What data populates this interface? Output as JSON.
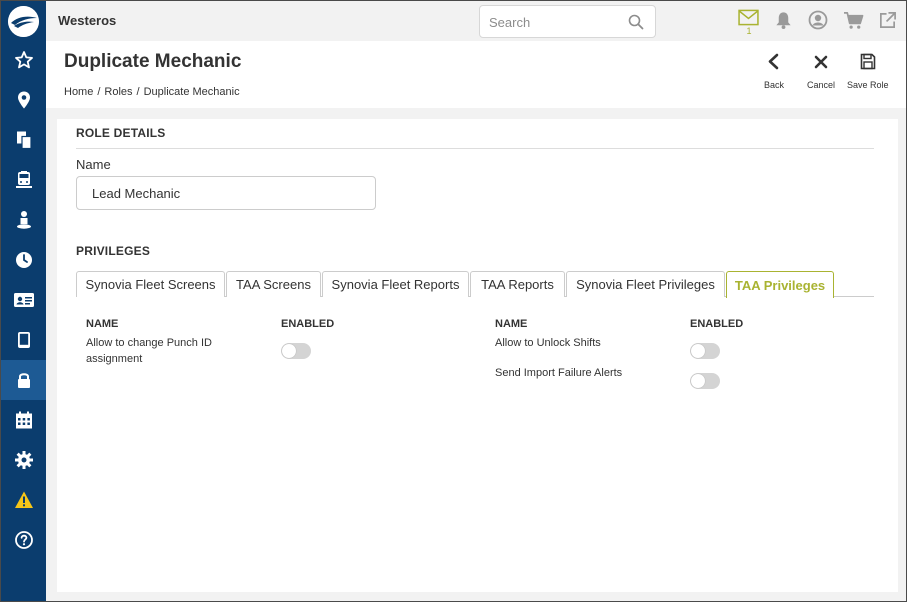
{
  "topbar": {
    "org_name": "Westeros",
    "search_placeholder": "Search",
    "mail_count": "1"
  },
  "header": {
    "title": "Duplicate Mechanic",
    "breadcrumb": [
      "Home",
      "Roles",
      "Duplicate Mechanic"
    ],
    "actions": {
      "back": "Back",
      "cancel": "Cancel",
      "save": "Save Role"
    }
  },
  "role_details": {
    "heading": "ROLE DETAILS",
    "name_label": "Name",
    "name_value": "Lead Mechanic"
  },
  "privileges": {
    "heading": "PRIVILEGES",
    "tabs": [
      "Synovia Fleet Screens",
      "TAA Screens",
      "Synovia Fleet Reports",
      "TAA Reports",
      "Synovia Fleet Privileges",
      "TAA Privileges"
    ],
    "active_tab": "TAA Privileges",
    "columns": {
      "name": "NAME",
      "enabled": "ENABLED"
    },
    "left_items": [
      {
        "label": "Allow to change Punch ID assignment",
        "enabled": false
      }
    ],
    "right_items": [
      {
        "label": "Allow to Unlock Shifts",
        "enabled": false
      },
      {
        "label": "Send Import Failure Alerts",
        "enabled": false
      }
    ]
  },
  "sidebar": {
    "items": [
      {
        "icon": "star-icon"
      },
      {
        "icon": "map-pin-icon"
      },
      {
        "icon": "documents-icon"
      },
      {
        "icon": "bus-icon"
      },
      {
        "icon": "person-icon"
      },
      {
        "icon": "clock-icon"
      },
      {
        "icon": "id-card-icon"
      },
      {
        "icon": "tablet-icon"
      },
      {
        "icon": "lock-icon",
        "active": true
      },
      {
        "icon": "calendar-icon"
      },
      {
        "icon": "gear-icon"
      },
      {
        "icon": "warning-icon"
      },
      {
        "icon": "help-icon"
      }
    ]
  },
  "colors": {
    "sidebar_bg": "#0b3d6e",
    "sidebar_active": "#1d5a94",
    "accent": "#a9b331",
    "warning": "#f5c518"
  }
}
